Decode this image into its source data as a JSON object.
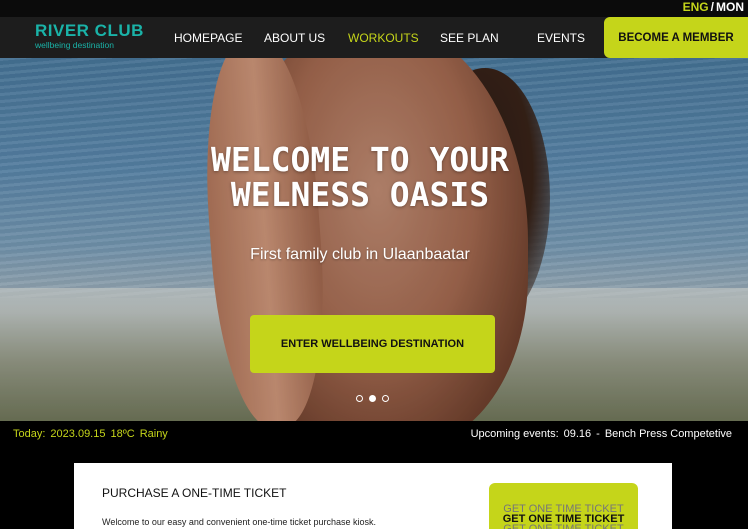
{
  "language": {
    "eng": "ENG",
    "separator": "/",
    "mon": "MON"
  },
  "logo": {
    "title": "RIVER CLUB",
    "subtitle": "wellbeing destination"
  },
  "nav": {
    "items": [
      {
        "label": "HOMEPAGE"
      },
      {
        "label": "ABOUT US"
      },
      {
        "label": "WORKOUTS",
        "active": true
      },
      {
        "label": "SEE PLAN"
      },
      {
        "label": "EVENTS"
      }
    ],
    "cta_label": "BECOME A MEMBER"
  },
  "hero": {
    "title_line1": "WELCOME TO YOUR",
    "title_line2": "WELNESS OASIS",
    "subtitle": "First family club in Ulaanbaatar",
    "cta_label": "ENTER WELLBEING DESTINATION",
    "slides": 3,
    "active_slide": 2
  },
  "status": {
    "today_label": "Today:",
    "date": "2023.09.15",
    "temperature": "18ºC",
    "weather": "Rainy",
    "events_label": "Upcoming events:",
    "event_date": "09.16",
    "event_separator": "-",
    "event_name": "Bench Press Competetive"
  },
  "ticket": {
    "title": "PURCHASE A ONE-TIME TICKET",
    "description": "Welcome to our easy and convenient one-time ticket purchase kiosk.",
    "button_label": "GET ONE TIME TICKET"
  },
  "colors": {
    "accent": "#c5d51a",
    "logo": "#1ab3a8",
    "nav_bg": "#1d1d1d"
  }
}
